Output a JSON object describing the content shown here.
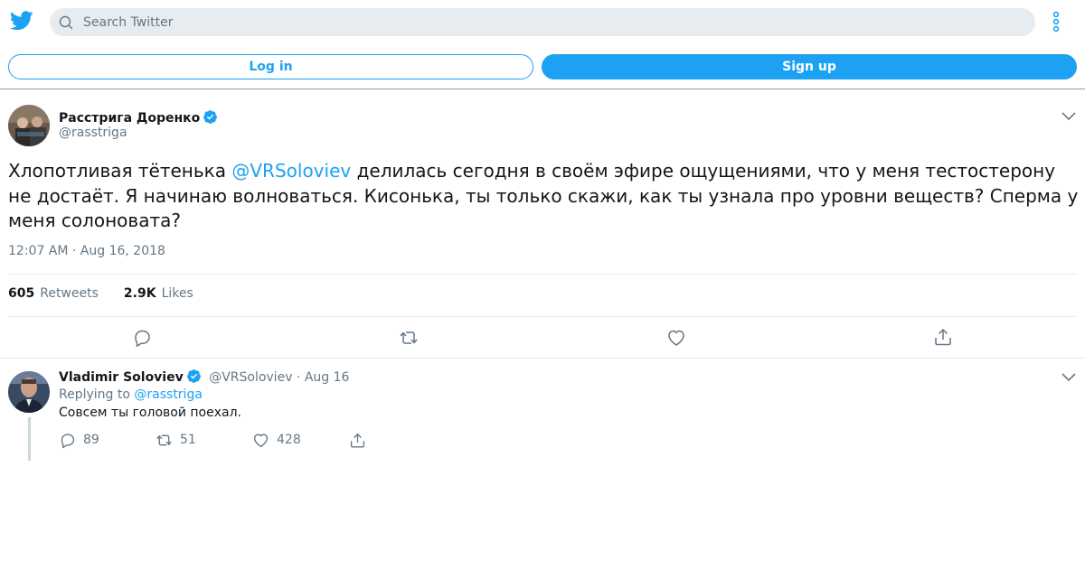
{
  "colors": {
    "accent": "#1da1f2",
    "text": "#14171a",
    "muted": "#657786",
    "search_bg": "#e6ecf0"
  },
  "header": {
    "logo_icon": "twitter-bird-icon",
    "search_placeholder": "Search Twitter",
    "more_icon": "vertical-dots-icon",
    "login_label": "Log in",
    "signup_label": "Sign up"
  },
  "tweet": {
    "author_name": "Расстрига Доренко",
    "author_handle": "@rasstriga",
    "verified": true,
    "text_before": "Хлопотливая тётенька ",
    "mention": "@VRSoloviev",
    "text_after": " делилась сегодня в своём эфире ощущениями, что у меня тестостерону не достаёт. Я начинаю волноваться. Кисонька, ты только скажи, как ты узнала про уровни веществ? Сперма у меня солоновата?",
    "timestamp": "12:07 AM · Aug 16, 2018",
    "retweets_count": "605",
    "retweets_label": "Retweets",
    "likes_count": "2.9K",
    "likes_label": "Likes",
    "actions": [
      "reply-icon",
      "retweet-icon",
      "like-icon",
      "share-icon"
    ]
  },
  "reply": {
    "author_name": "Vladimir Soloviev",
    "author_handle": "@VRSoloviev",
    "separator": " · ",
    "date": "Aug 16",
    "replying_prefix": "Replying to ",
    "replying_to": "@rasstriga",
    "text": "Совсем ты головой поехал.",
    "reply_count": "89",
    "retweet_count": "51",
    "like_count": "428"
  }
}
